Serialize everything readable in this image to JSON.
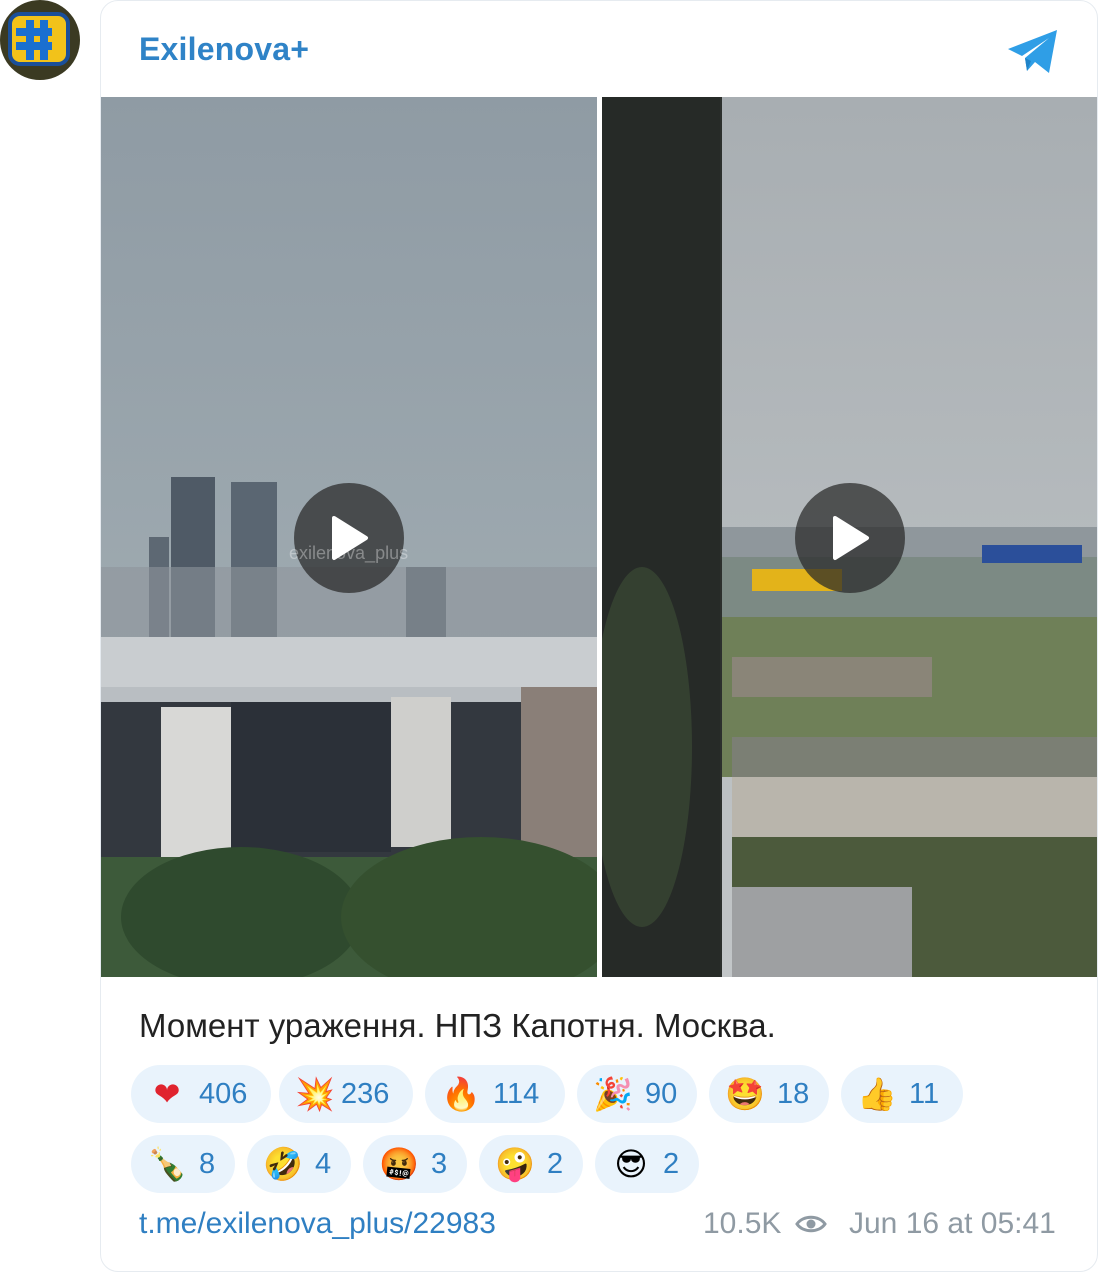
{
  "channel": {
    "name": "Exilenova+"
  },
  "post": {
    "caption": "Момент ураження. НПЗ Капотня. Москва.",
    "watermark": "exilenova_plus",
    "link": "t.me/exilenova_plus/22983",
    "views": "10.5K",
    "date": "Jun 16 at 05:41"
  },
  "reactions": [
    {
      "emoji": "❤",
      "icon": "heart-icon",
      "count": "406"
    },
    {
      "emoji": "💥",
      "icon": "explosion-icon",
      "count": "236"
    },
    {
      "emoji": "🔥",
      "icon": "fire-icon",
      "count": "114"
    },
    {
      "emoji": "🎉",
      "icon": "party-popper-icon",
      "count": "90"
    },
    {
      "emoji": "🤩",
      "icon": "star-struck-icon",
      "count": "18"
    },
    {
      "emoji": "👍",
      "icon": "thumbs-up-icon",
      "count": "11"
    },
    {
      "emoji": "🍾",
      "icon": "champagne-icon",
      "count": "8"
    },
    {
      "emoji": "🤣",
      "icon": "rofl-icon",
      "count": "4"
    },
    {
      "emoji": "🤬",
      "icon": "cursing-face-icon",
      "count": "3"
    },
    {
      "emoji": "🤪",
      "icon": "zany-face-icon",
      "count": "2"
    },
    {
      "emoji": "😎",
      "icon": "sunglasses-face-icon",
      "count": "2"
    }
  ],
  "colors": {
    "accent": "#2f83c7",
    "reaction_bg": "#e9f3fc",
    "meta": "#8f9aa3"
  }
}
